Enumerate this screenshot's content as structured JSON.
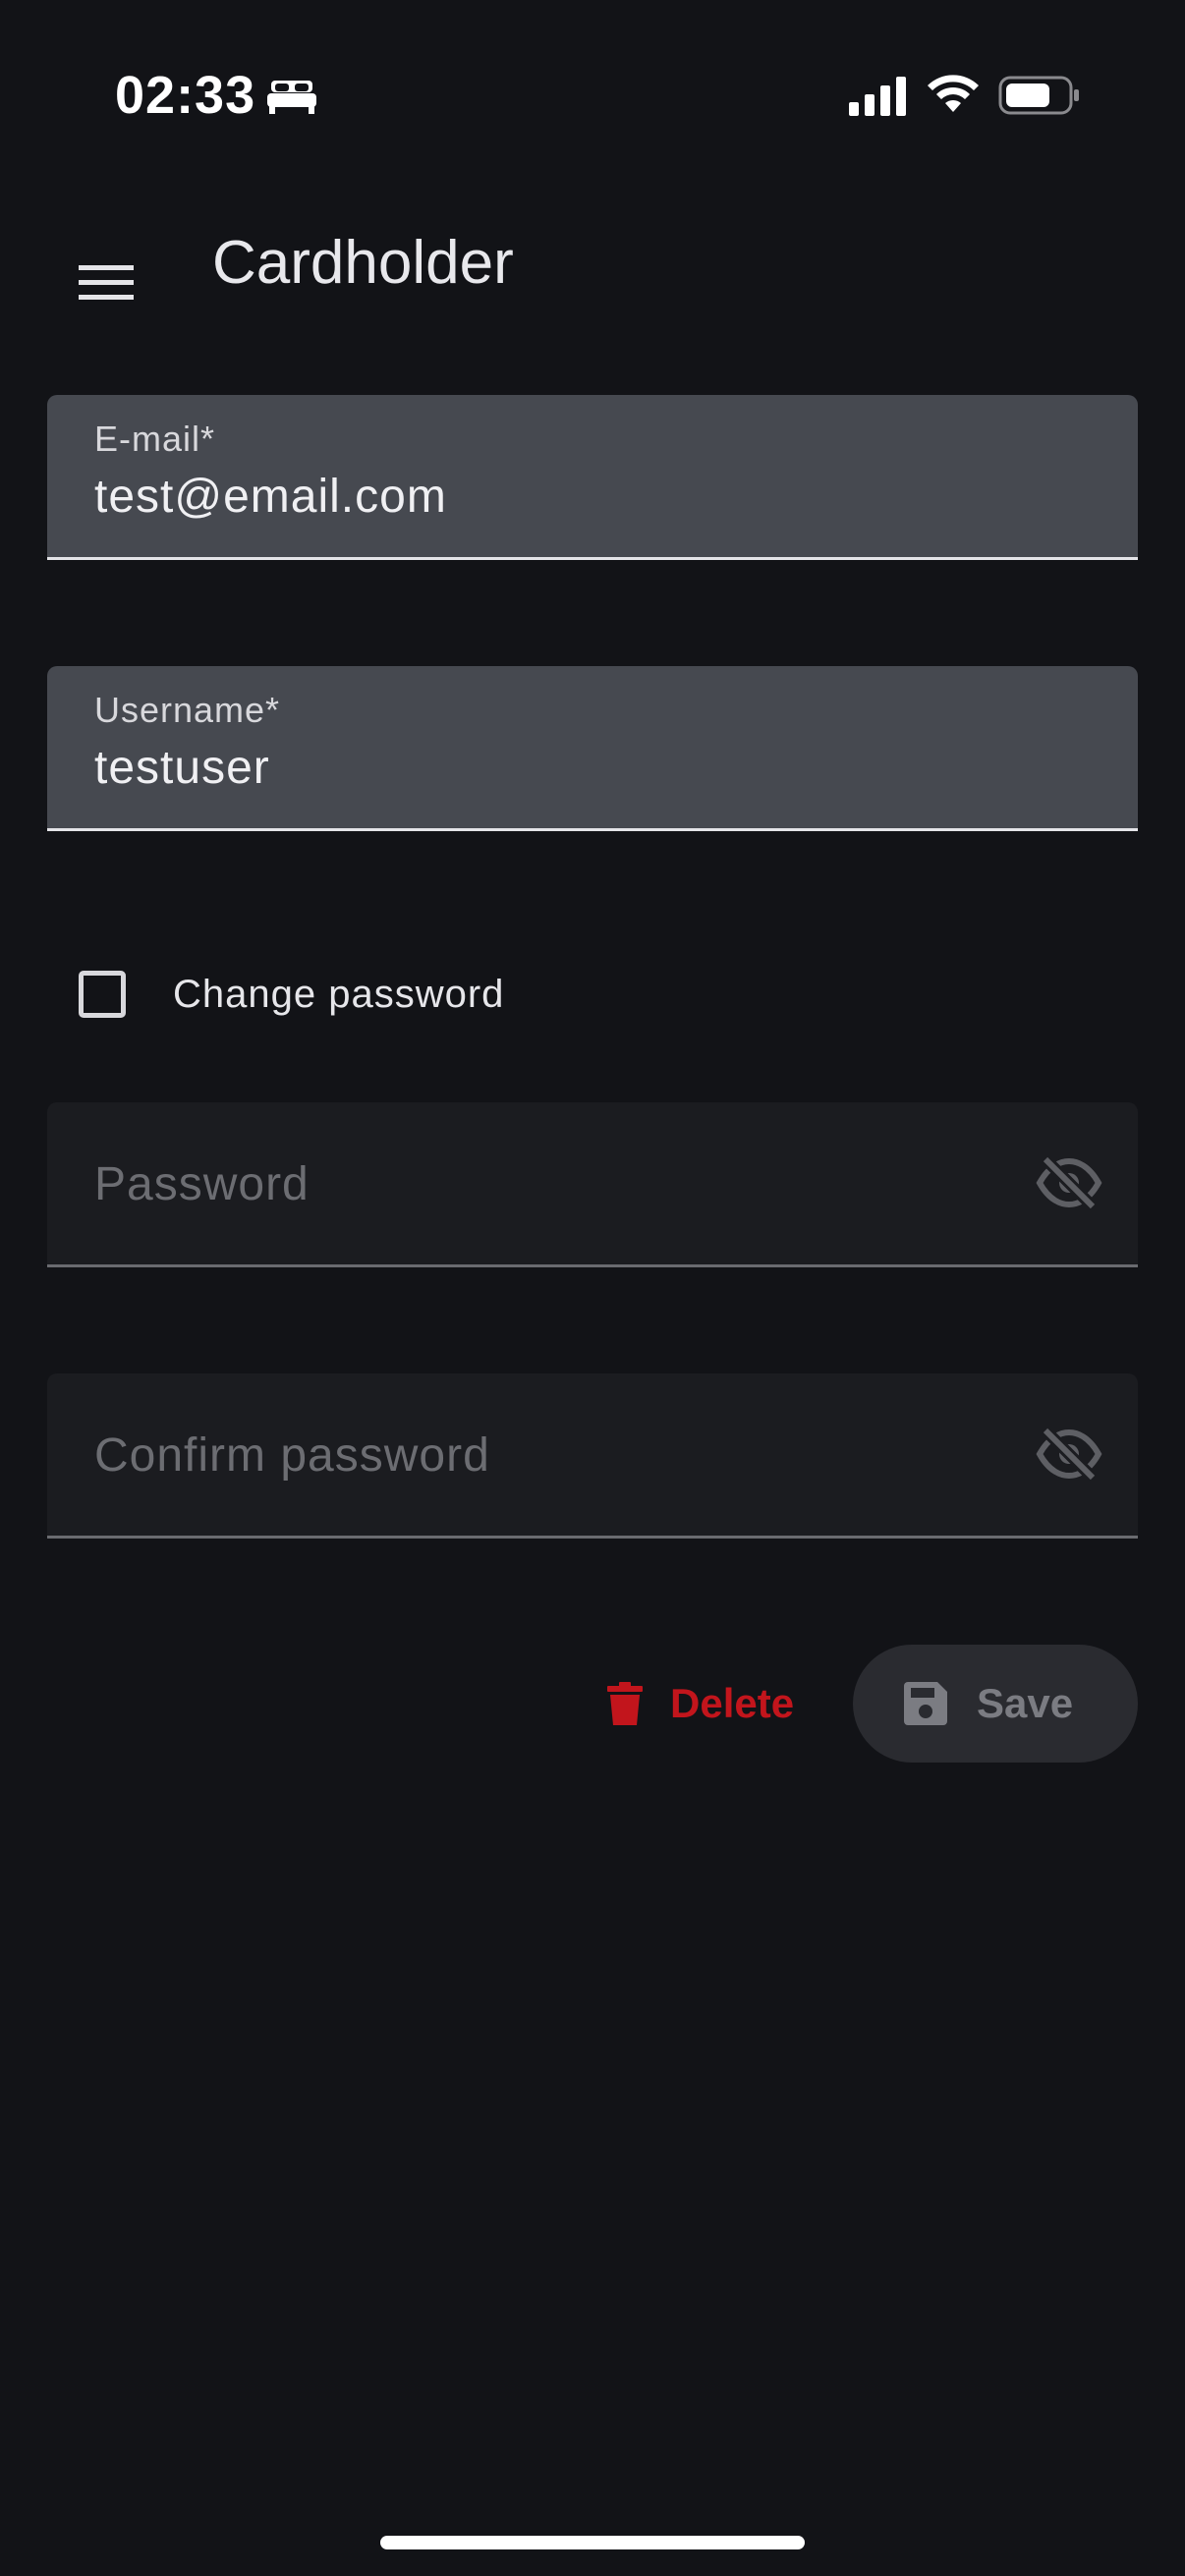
{
  "status_bar": {
    "time": "02:33",
    "icons": [
      "bed-icon",
      "signal-icon",
      "wifi-icon",
      "battery-icon"
    ]
  },
  "app_bar": {
    "menu_icon": "hamburger-menu-icon",
    "title": "Cardholder"
  },
  "form": {
    "email": {
      "label": "E-mail*",
      "value": "test@email.com"
    },
    "username": {
      "label": "Username*",
      "value": "testuser"
    },
    "change_password": {
      "label": "Change password",
      "checked": false
    },
    "password": {
      "placeholder": "Password",
      "icon": "eye-off-icon"
    },
    "confirm_password": {
      "placeholder": "Confirm password",
      "icon": "eye-off-icon"
    }
  },
  "actions": {
    "delete_label": "Delete",
    "save_label": "Save",
    "delete_icon": "trash-icon",
    "save_icon": "floppy-disk-icon"
  },
  "colors": {
    "background": "#121317",
    "filled_field": "#464950",
    "empty_field": "#1b1c20",
    "delete": "#c2151c",
    "save_disabled_bg": "#2a2b30",
    "save_disabled_text": "#7b7c82"
  }
}
